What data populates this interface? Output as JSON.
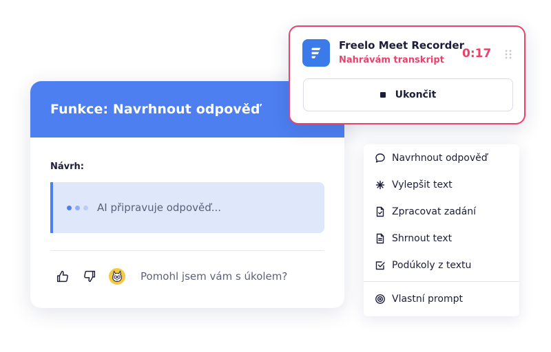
{
  "main_card": {
    "title": "Funkce: Navrhnout odpověď",
    "draft_label": "Návrh:",
    "ai_status": "AI připravuje odpověď...",
    "feedback_question": "Pomohl jsem vám s úkolem?"
  },
  "recorder": {
    "app_name": "Freelo Meet Recorder",
    "status": "Nahrávám transkript",
    "timer": "0:17",
    "stop_label": "Ukončit"
  },
  "menu": {
    "items": [
      {
        "label": "Navrhnout odpověď",
        "icon": "chat-bubble-icon"
      },
      {
        "label": "Vylepšit text",
        "icon": "sparkle-icon"
      },
      {
        "label": "Zpracovat zadání",
        "icon": "document-check-icon"
      },
      {
        "label": "Shrnout text",
        "icon": "document-text-icon"
      },
      {
        "label": "Podúkoly z textu",
        "icon": "checkbox-icon"
      }
    ],
    "custom": {
      "label": "Vlastní prompt",
      "icon": "target-icon"
    }
  },
  "colors": {
    "accent_blue": "#4e7ff0",
    "recording_red": "#e8436a",
    "text_dark": "#1b1d3a",
    "draft_background": "#dfe8fa"
  }
}
